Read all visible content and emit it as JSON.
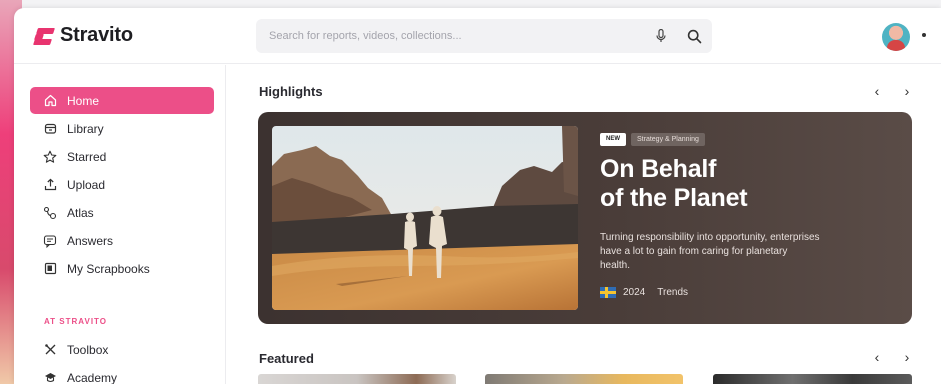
{
  "brand": {
    "name": "Stravito",
    "accent": "#ec4f88"
  },
  "search": {
    "placeholder": "Search for reports, videos, collections..."
  },
  "icons": {
    "mic": "mic-icon",
    "search": "search-icon",
    "avatar": "user-avatar"
  },
  "sidebar": {
    "items": [
      {
        "label": "Home",
        "icon": "home-icon",
        "active": true
      },
      {
        "label": "Library",
        "icon": "library-icon"
      },
      {
        "label": "Starred",
        "icon": "star-icon"
      },
      {
        "label": "Upload",
        "icon": "upload-icon"
      },
      {
        "label": "Atlas",
        "icon": "atlas-icon"
      },
      {
        "label": "Answers",
        "icon": "answers-icon"
      },
      {
        "label": "My Scrapbooks",
        "icon": "scrapbook-icon"
      }
    ],
    "section_label": "AT STRAVITO",
    "section_items": [
      {
        "label": "Toolbox",
        "icon": "toolbox-icon"
      },
      {
        "label": "Academy",
        "icon": "academy-icon"
      }
    ]
  },
  "highlights": {
    "title": "Highlights",
    "card": {
      "tag_new": "NEW",
      "tag_category": "Strategy & Planning",
      "title_line1": "On Behalf",
      "title_line2": "of the Planet",
      "description": "Turning responsibility into opportunity, enterprises have a lot to gain from caring for planetary health.",
      "year": "2024",
      "type": "Trends"
    }
  },
  "featured": {
    "title": "Featured"
  },
  "nav_arrows": {
    "prev": "‹",
    "next": "›"
  }
}
